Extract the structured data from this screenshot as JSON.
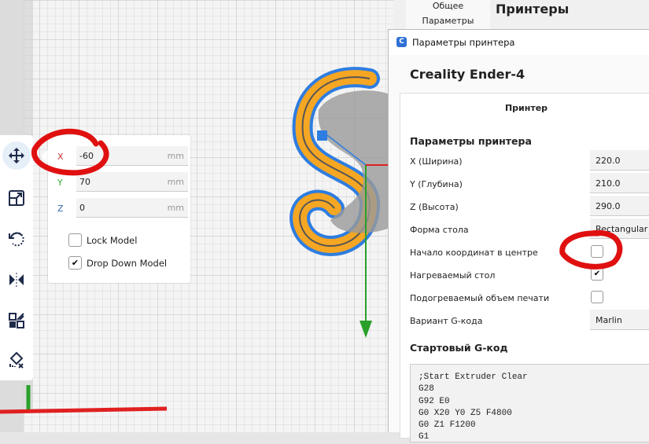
{
  "viewport": {
    "move_panel": {
      "x_label": "X",
      "x_value": "-60",
      "y_label": "Y",
      "y_value": "70",
      "z_label": "Z",
      "z_value": "0",
      "unit": "mm",
      "lock_model_label": "Lock Model",
      "lock_model_checked": false,
      "drop_down_label": "Drop Down Model",
      "drop_down_checked": true
    },
    "tools": [
      "move-icon",
      "scale-icon",
      "rotate-icon",
      "mirror-icon",
      "per-model-settings-icon",
      "support-blocker-icon"
    ],
    "colors": {
      "model": "#f5a623",
      "outline": "#2e7de0",
      "annotation": "#e01010"
    }
  },
  "preferences": {
    "sidebar": [
      "Общее",
      "Параметры"
    ],
    "title": "Принтеры"
  },
  "dialog": {
    "title": "Параметры принтера",
    "printer_name": "Creality Ender-4",
    "tab": "Принтер",
    "section_printer": "Параметры принтера",
    "fields": [
      {
        "label": "X (Ширина)",
        "value": "220.0"
      },
      {
        "label": "Y (Глубина)",
        "value": "210.0"
      },
      {
        "label": "Z (Высота)",
        "value": "290.0"
      },
      {
        "label": "Форма стола",
        "value": "Rectangular"
      }
    ],
    "checks": [
      {
        "label": "Начало координат в центре",
        "checked": false
      },
      {
        "label": "Нагреваемый стол",
        "checked": true
      },
      {
        "label": "Подогреваемый объем печати",
        "checked": false
      }
    ],
    "gcode_flavor": {
      "label": "Вариант G-кода",
      "value": "Marlin"
    },
    "section_start_gcode": "Стартовый G-код",
    "start_gcode": ";Start Extruder Clear\nG28\nG92 E0\nG0 X20 Y0 Z5 F4800\nG0 Z1 F1200\nG1"
  }
}
